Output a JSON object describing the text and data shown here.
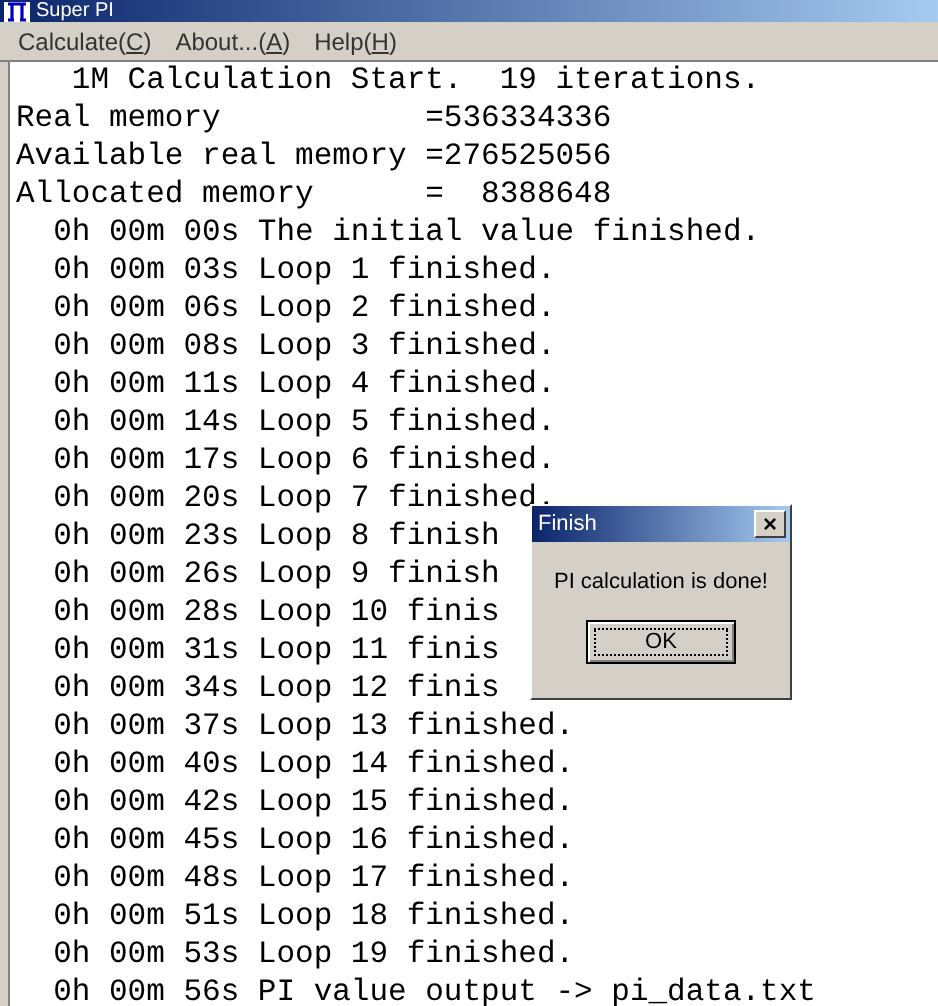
{
  "window": {
    "title": "Super PI"
  },
  "menu": [
    {
      "before": "Calculate(",
      "key": "C",
      "after": ")"
    },
    {
      "before": "About...(",
      "key": "A",
      "after": ")"
    },
    {
      "before": "Help(",
      "key": "H",
      "after": ")"
    }
  ],
  "output_lines": [
    "   1M Calculation Start.  19 iterations.",
    "Real memory           =536334336",
    "Available real memory =276525056",
    "Allocated memory      =  8388648",
    "  0h 00m 00s The initial value finished.",
    "  0h 00m 03s Loop 1 finished.",
    "  0h 00m 06s Loop 2 finished.",
    "  0h 00m 08s Loop 3 finished.",
    "  0h 00m 11s Loop 4 finished.",
    "  0h 00m 14s Loop 5 finished.",
    "  0h 00m 17s Loop 6 finished.",
    "  0h 00m 20s Loop 7 finished.",
    "  0h 00m 23s Loop 8 finish",
    "  0h 00m 26s Loop 9 finish",
    "  0h 00m 28s Loop 10 finis",
    "  0h 00m 31s Loop 11 finis",
    "  0h 00m 34s Loop 12 finis",
    "  0h 00m 37s Loop 13 finished.",
    "  0h 00m 40s Loop 14 finished.",
    "  0h 00m 42s Loop 15 finished.",
    "  0h 00m 45s Loop 16 finished.",
    "  0h 00m 48s Loop 17 finished.",
    "  0h 00m 51s Loop 18 finished.",
    "  0h 00m 53s Loop 19 finished.",
    "  0h 00m 56s PI value output -> pi_data.txt"
  ],
  "dialog": {
    "title": "Finish",
    "close": "×",
    "message": "PI calculation is done!",
    "button": "OK"
  }
}
